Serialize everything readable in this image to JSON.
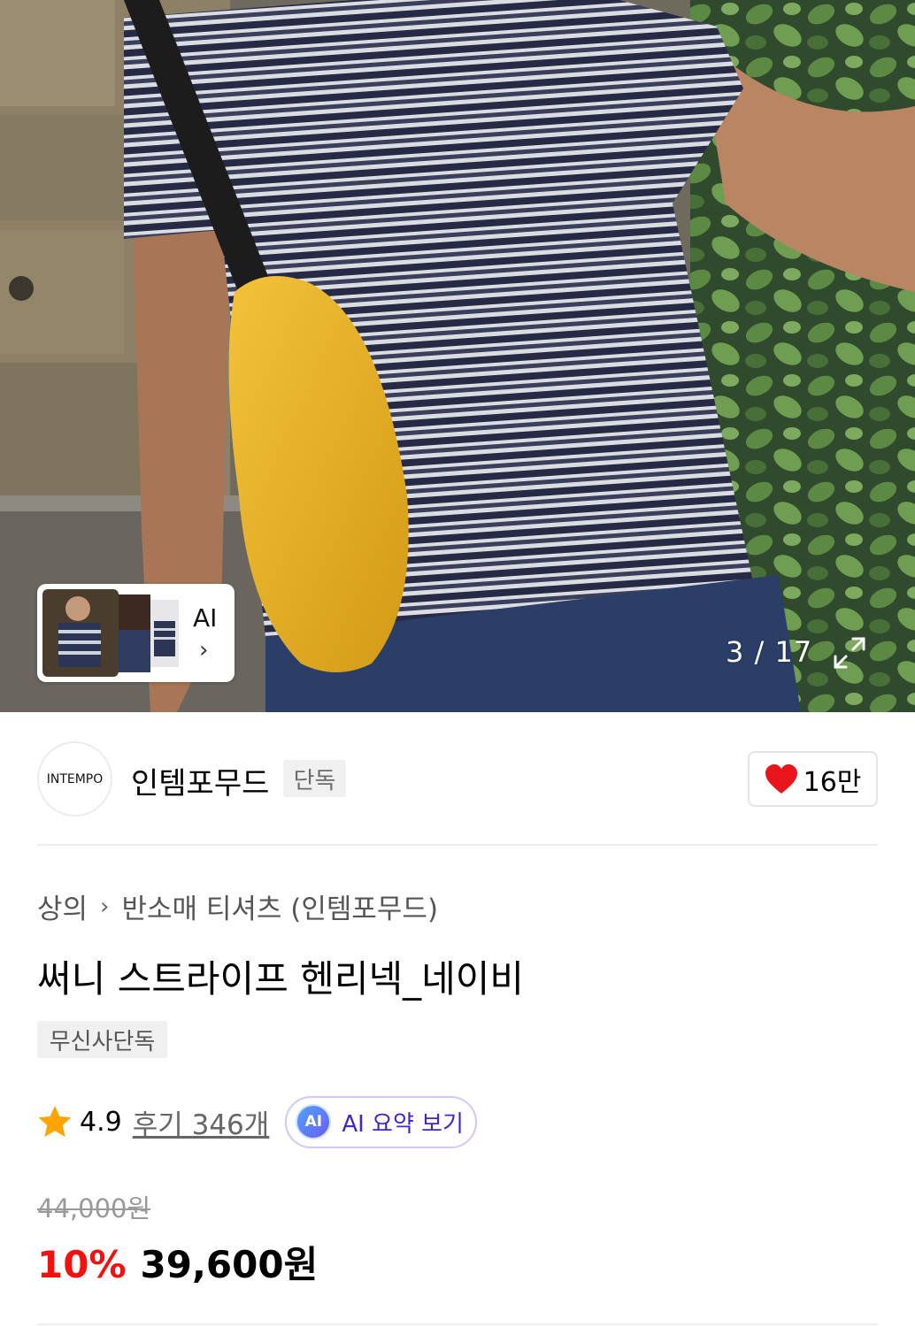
{
  "gallery": {
    "ai_label": "AI",
    "counter": "3 / 17"
  },
  "brand": {
    "logo_text": "INTEMPO",
    "name": "인템포무드",
    "tag": "단독",
    "likes": "16만"
  },
  "product": {
    "breadcrumb": [
      "상의",
      "반소매 티셔츠 (인템포무드)"
    ],
    "title": "써니 스트라이프 헨리넥_네이비",
    "badge": "무신사단독"
  },
  "rating": {
    "value": "4.9",
    "reviews": "후기 346개",
    "ai_badge": "AI",
    "ai_summary": "AI 요약 보기"
  },
  "price": {
    "original": "44,000원",
    "discount": "10%",
    "sale": "39,600원"
  },
  "colors": {
    "discount_red": "#f31110",
    "heart_red": "#e8151c",
    "star_orange": "#ffa400",
    "ai_purple": "#3f27c9"
  },
  "icons": {
    "chevron": "chevron-right-icon",
    "expand": "expand-icon",
    "heart": "heart-icon",
    "star": "star-icon"
  }
}
